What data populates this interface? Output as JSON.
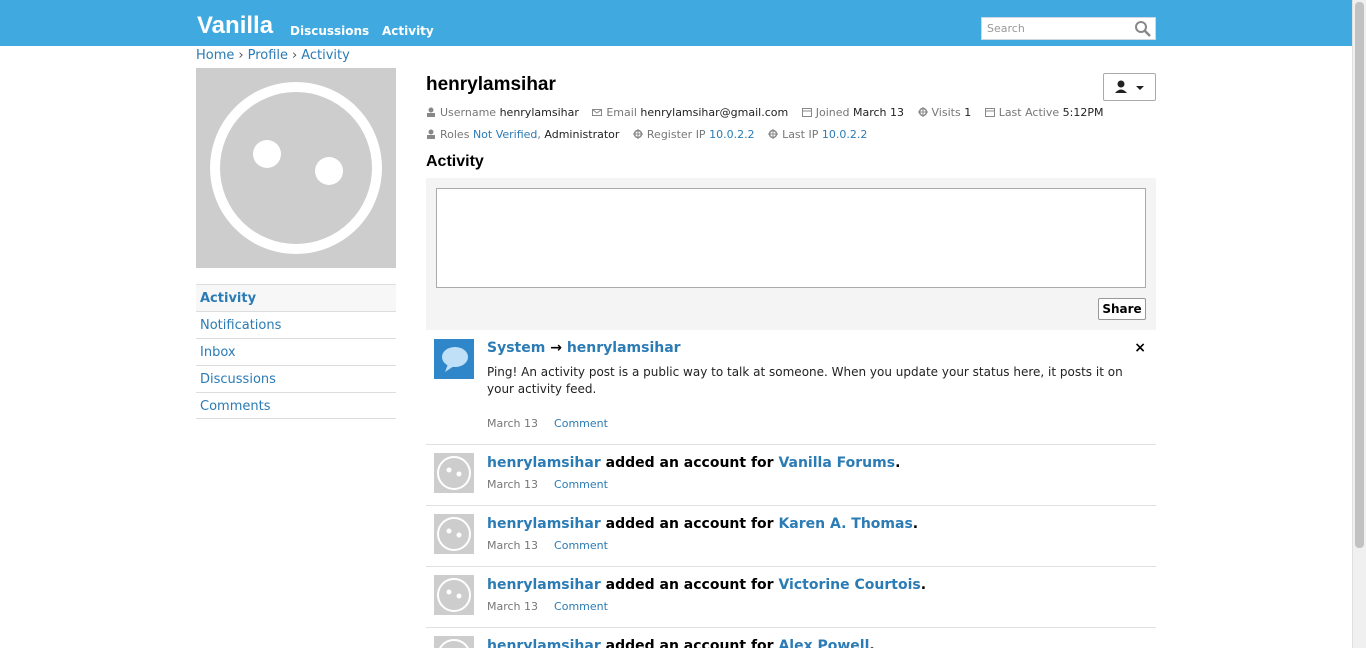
{
  "header": {
    "brand": "Vanilla",
    "nav": [
      "Discussions",
      "Activity"
    ],
    "search_placeholder": "Search"
  },
  "breadcrumb": [
    "Home",
    "Profile",
    "Activity"
  ],
  "sidebar": {
    "items": [
      {
        "label": "Activity",
        "active": true
      },
      {
        "label": "Notifications"
      },
      {
        "label": "Inbox"
      },
      {
        "label": "Discussions"
      },
      {
        "label": "Comments"
      }
    ]
  },
  "profile": {
    "name": "henrylamsihar",
    "fields": {
      "username_label": "Username",
      "username": "henrylamsihar",
      "email_label": "Email",
      "email": "henrylamsihar@gmail.com",
      "joined_label": "Joined",
      "joined": "March 13",
      "visits_label": "Visits",
      "visits": "1",
      "last_active_label": "Last Active",
      "last_active": "5:12PM",
      "roles_label": "Roles",
      "role_1": "Not Verified",
      "role_2": "Administrator",
      "register_ip_label": "Register IP",
      "register_ip": "10.0.2.2",
      "last_ip_label": "Last IP",
      "last_ip": "10.0.2.2"
    }
  },
  "activity": {
    "title": "Activity",
    "share_label": "Share",
    "close_glyph": "×",
    "arrow": "→",
    "items": [
      {
        "actor": "System",
        "target": "henrylamsihar",
        "body": "Ping! An activity post is a public way to talk at someone. When you update your status here, it posts it on your activity feed.",
        "date": "March 13",
        "comment": "Comment"
      },
      {
        "actor": "henrylamsihar",
        "text": "added an account for",
        "object": "Vanilla Forums",
        "end": ".",
        "date": "March 13",
        "comment": "Comment"
      },
      {
        "actor": "henrylamsihar",
        "text": "added an account for",
        "object": "Karen A. Thomas",
        "end": ".",
        "date": "March 13",
        "comment": "Comment"
      },
      {
        "actor": "henrylamsihar",
        "text": "added an account for",
        "object": "Victorine Courtois",
        "end": ".",
        "date": "March 13",
        "comment": "Comment"
      },
      {
        "actor": "henrylamsihar",
        "text": "added an account for",
        "object": "Alex Powell",
        "end": ".",
        "date": "",
        "comment": ""
      }
    ]
  },
  "colors": {
    "topbar": "#3fa9e0",
    "link": "#2b7bb5"
  },
  "icons": [
    "search-icon",
    "user-icon",
    "caret-down-icon",
    "email-icon",
    "calendar-icon",
    "visits-icon",
    "roles-icon",
    "ip-icon",
    "speech-bubble-icon",
    "close-icon",
    "avatar-face-icon"
  ]
}
